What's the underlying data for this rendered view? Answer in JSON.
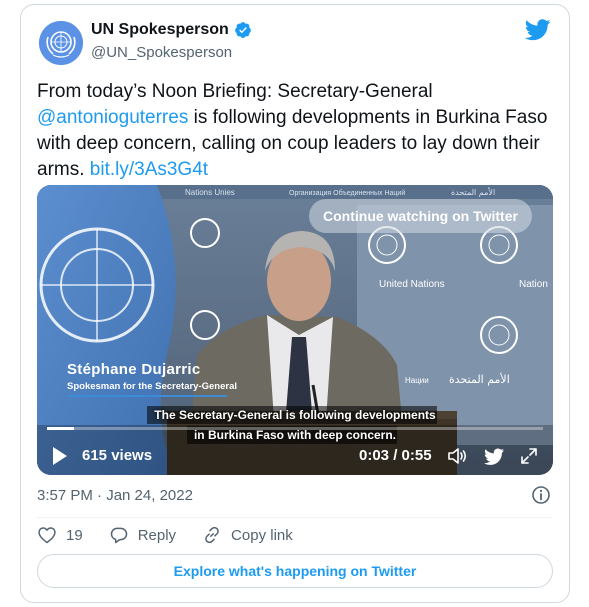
{
  "author": {
    "name": "UN Spokesperson",
    "handle": "@UN_Spokesperson",
    "avatar_icon": "un-emblem-icon",
    "verified": true
  },
  "tweet": {
    "text_start": "From today’s Noon Briefing: Secretary-General ",
    "mention": "@antonioguterres",
    "text_middle": " is following developments in Burkina Faso with deep concern, calling on coup leaders to lay down their arms. ",
    "link": "bit.ly/3As3G4t"
  },
  "video": {
    "continue_label": "Continue watching on Twitter",
    "speaker_name": "Stéphane Dujarric",
    "speaker_title": "Spokesman for the Secretary-General",
    "caption_line1": "The Secretary-General is following developments",
    "caption_line2": "in Burkina Faso with deep concern.",
    "views": "615 views",
    "timecode": "0:03 / 0:55",
    "progress_fraction": 0.055,
    "background_labels": {
      "un_english": "United Nations",
      "un_english_cut": "Nation",
      "un_arabic": "الأمم المتحدة",
      "un_russian_cut": "Нации",
      "un_french_cut": "Nations Unies",
      "un_russian_top": "Организация Объединенных Наций",
      "un_arabic_top": "الأمم المتحدة"
    }
  },
  "meta": {
    "timestamp": "3:57 PM · Jan 24, 2022"
  },
  "actions": {
    "likes": "19",
    "reply_label": "Reply",
    "copy_label": "Copy link"
  },
  "explore_label": "Explore what's happening on Twitter",
  "colors": {
    "accent": "#1d9bf0",
    "text": "#0f1419",
    "muted": "#536471",
    "border": "#cfd9de"
  }
}
